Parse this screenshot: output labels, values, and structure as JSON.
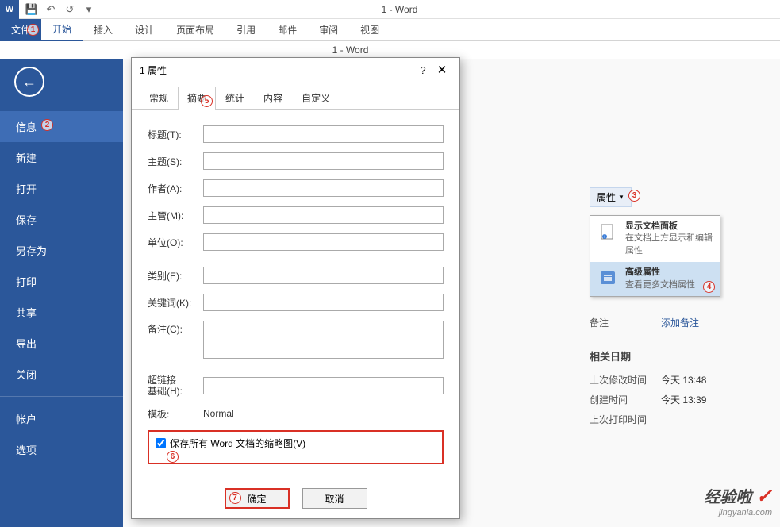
{
  "titlebar": {
    "title": "1 - Word"
  },
  "subtitle": "1 - Word",
  "ribbon": {
    "file": "文件",
    "tabs": [
      "开始",
      "插入",
      "设计",
      "页面布局",
      "引用",
      "邮件",
      "审阅",
      "视图"
    ]
  },
  "sidebar": {
    "items": [
      "信息",
      "新建",
      "打开",
      "保存",
      "另存为",
      "打印",
      "共享",
      "导出",
      "关闭"
    ],
    "bottom": [
      "帐户",
      "选项"
    ]
  },
  "props": {
    "button": "属性",
    "dd1_title": "显示文档面板",
    "dd1_sub": "在文档上方显示和编辑属性",
    "dd2_title": "高级属性",
    "dd2_sub": "查看更多文档属性",
    "remark_label": "备注",
    "remark_val": "添加备注",
    "dates_title": "相关日期",
    "mod_label": "上次修改时间",
    "mod_val": "今天 13:48",
    "create_label": "创建时间",
    "create_val": "今天 13:39",
    "print_label": "上次打印时间"
  },
  "dialog": {
    "title": "1 属性",
    "tabs": [
      "常规",
      "摘要",
      "统计",
      "内容",
      "自定义"
    ],
    "fields": {
      "title": "标题(T):",
      "subject": "主题(S):",
      "author": "作者(A):",
      "manager": "主管(M):",
      "company": "单位(O):",
      "category": "类别(E):",
      "keywords": "关键词(K):",
      "comments": "备注(C):",
      "hyperlink": "超链接\n基础(H):",
      "template": "模板:"
    },
    "template_val": "Normal",
    "checkbox": "保存所有 Word 文档的缩略图(V)",
    "ok": "确定",
    "cancel": "取消"
  },
  "watermark": {
    "top": "经验啦",
    "sub": "jingyanla.com"
  }
}
